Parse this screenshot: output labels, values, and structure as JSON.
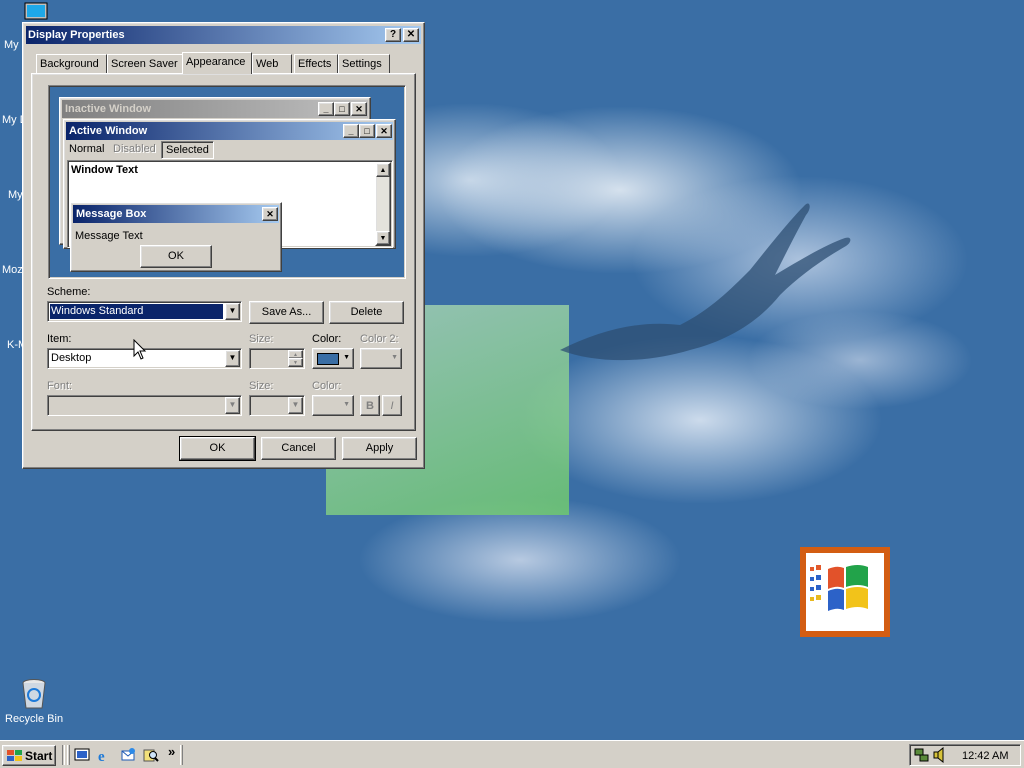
{
  "desktop": {
    "icons": [
      {
        "label": "My",
        "name": "my-computer"
      },
      {
        "label": "My D",
        "name": "my-documents"
      },
      {
        "label": "My",
        "name": "my-network-places"
      },
      {
        "label": "Moz",
        "name": "mozilla"
      },
      {
        "label": "K-M",
        "name": "k-meleon"
      },
      {
        "label": "Recycle Bin",
        "name": "recycle-bin"
      }
    ]
  },
  "dialog": {
    "title": "Display Properties",
    "help_label": "?",
    "close_label": "✕",
    "tabs": [
      "Background",
      "Screen Saver",
      "Appearance",
      "Web",
      "Effects",
      "Settings"
    ],
    "active_tab": "Appearance",
    "preview": {
      "inactive_title": "Inactive Window",
      "active_title": "Active Window",
      "menu": [
        "Normal",
        "Disabled",
        "Selected"
      ],
      "window_text": "Window Text",
      "message_box_title": "Message Box",
      "message_text": "Message Text",
      "ok_label": "OK"
    },
    "scheme_label": "Scheme:",
    "scheme_value": "Windows Standard",
    "save_as_label": "Save As...",
    "delete_label": "Delete",
    "item_label": "Item:",
    "item_value": "Desktop",
    "size_label": "Size:",
    "color_label": "Color:",
    "color2_label": "Color 2:",
    "font_label": "Font:",
    "font_size_label": "Size:",
    "font_color_label": "Color:",
    "bold_label": "B",
    "italic_label": "I",
    "selected_color": "#3a6ea5",
    "ok_label": "OK",
    "cancel_label": "Cancel",
    "apply_label": "Apply"
  },
  "taskbar": {
    "start_label": "Start",
    "quick_launch": [
      "show-desktop-icon",
      "internet-explorer-icon",
      "outlook-express-icon",
      "search-icon"
    ],
    "more_label": "»",
    "clock": "12:42 AM"
  },
  "colors": {
    "desktop": "#3a6ea5",
    "active_title_start": "#0a246a",
    "active_title_end": "#a6caf0",
    "inactive_title_start": "#808080",
    "inactive_title_end": "#c0c0c0",
    "face": "#d4d0c8",
    "logo_border": "#d35d12"
  }
}
